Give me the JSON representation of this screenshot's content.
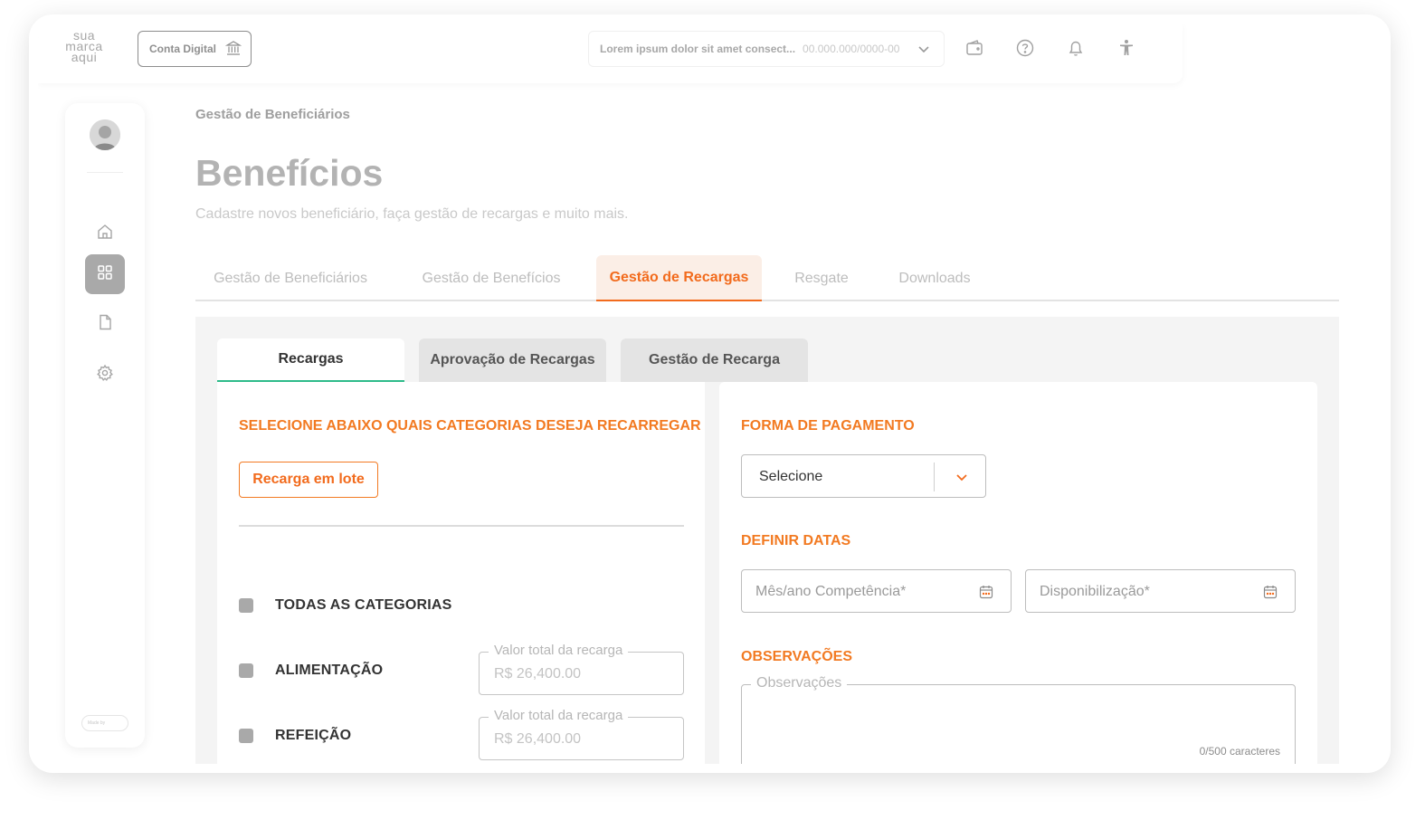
{
  "brand": {
    "logo_line1": "sua",
    "logo_line2": "marca",
    "logo_line3": "aqui"
  },
  "topbar": {
    "conta_digital_label": "Conta Digital",
    "company_name": "Lorem ipsum dolor sit amet consect...",
    "company_cnpj": "00.000.000/0000-00",
    "icons": [
      "wallet-icon",
      "help-icon",
      "bell-icon",
      "accessibility-icon"
    ]
  },
  "sidebar": {
    "items": [
      {
        "name": "home",
        "icon": "home-icon",
        "active": false
      },
      {
        "name": "dashboard",
        "icon": "grid-icon",
        "active": true
      },
      {
        "name": "documents",
        "icon": "document-icon",
        "active": false
      },
      {
        "name": "settings",
        "icon": "gear-icon",
        "active": false
      }
    ],
    "made_by": "Made by"
  },
  "page": {
    "breadcrumb": "Gestão de Beneficiários",
    "title": "Benefícios",
    "subtitle": "Cadastre novos beneficiário, faça gestão de recargas e muito mais."
  },
  "main_tabs": [
    {
      "label": "Gestão de Beneficiários",
      "active": false
    },
    {
      "label": "Gestão de Benefícios",
      "active": false
    },
    {
      "label": "Gestão de Recargas",
      "active": true
    },
    {
      "label": "Resgate",
      "active": false
    },
    {
      "label": "Downloads",
      "active": false
    }
  ],
  "sub_tabs": [
    {
      "label": "Recargas",
      "active": true
    },
    {
      "label": "Aprovação de Recargas",
      "active": false
    },
    {
      "label": "Gestão de Recarga",
      "active": false
    }
  ],
  "left_panel": {
    "section_title": "SELECIONE ABAIXO QUAIS CATEGORIAS DESEJA RECARREGAR",
    "lote_button": "Recarga em lote",
    "all_categories": "TODAS AS CATEGORIAS",
    "categories": [
      {
        "label": "ALIMENTAÇÃO",
        "field_label": "Valor total da recarga",
        "value": "R$ 26,400.00"
      },
      {
        "label": "REFEIÇÃO",
        "field_label": "Valor total da recarga",
        "value": "R$ 26,400.00"
      }
    ]
  },
  "right_panel": {
    "payment_title": "FORMA DE PAGAMENTO",
    "payment_value": "Selecione",
    "dates_title": "DEFINIR DATAS",
    "competencia_placeholder": "Mês/ano Competência*",
    "disponibilizacao_placeholder": "Disponibilização*",
    "obs_title": "OBSERVAÇÕES",
    "obs_label": "Observações",
    "obs_counter": "0/500 caracteres"
  },
  "colors": {
    "accent": "#f26b1d",
    "tab_underline": "#2dbb8a",
    "sidebar_active": "#a9a9a9"
  }
}
